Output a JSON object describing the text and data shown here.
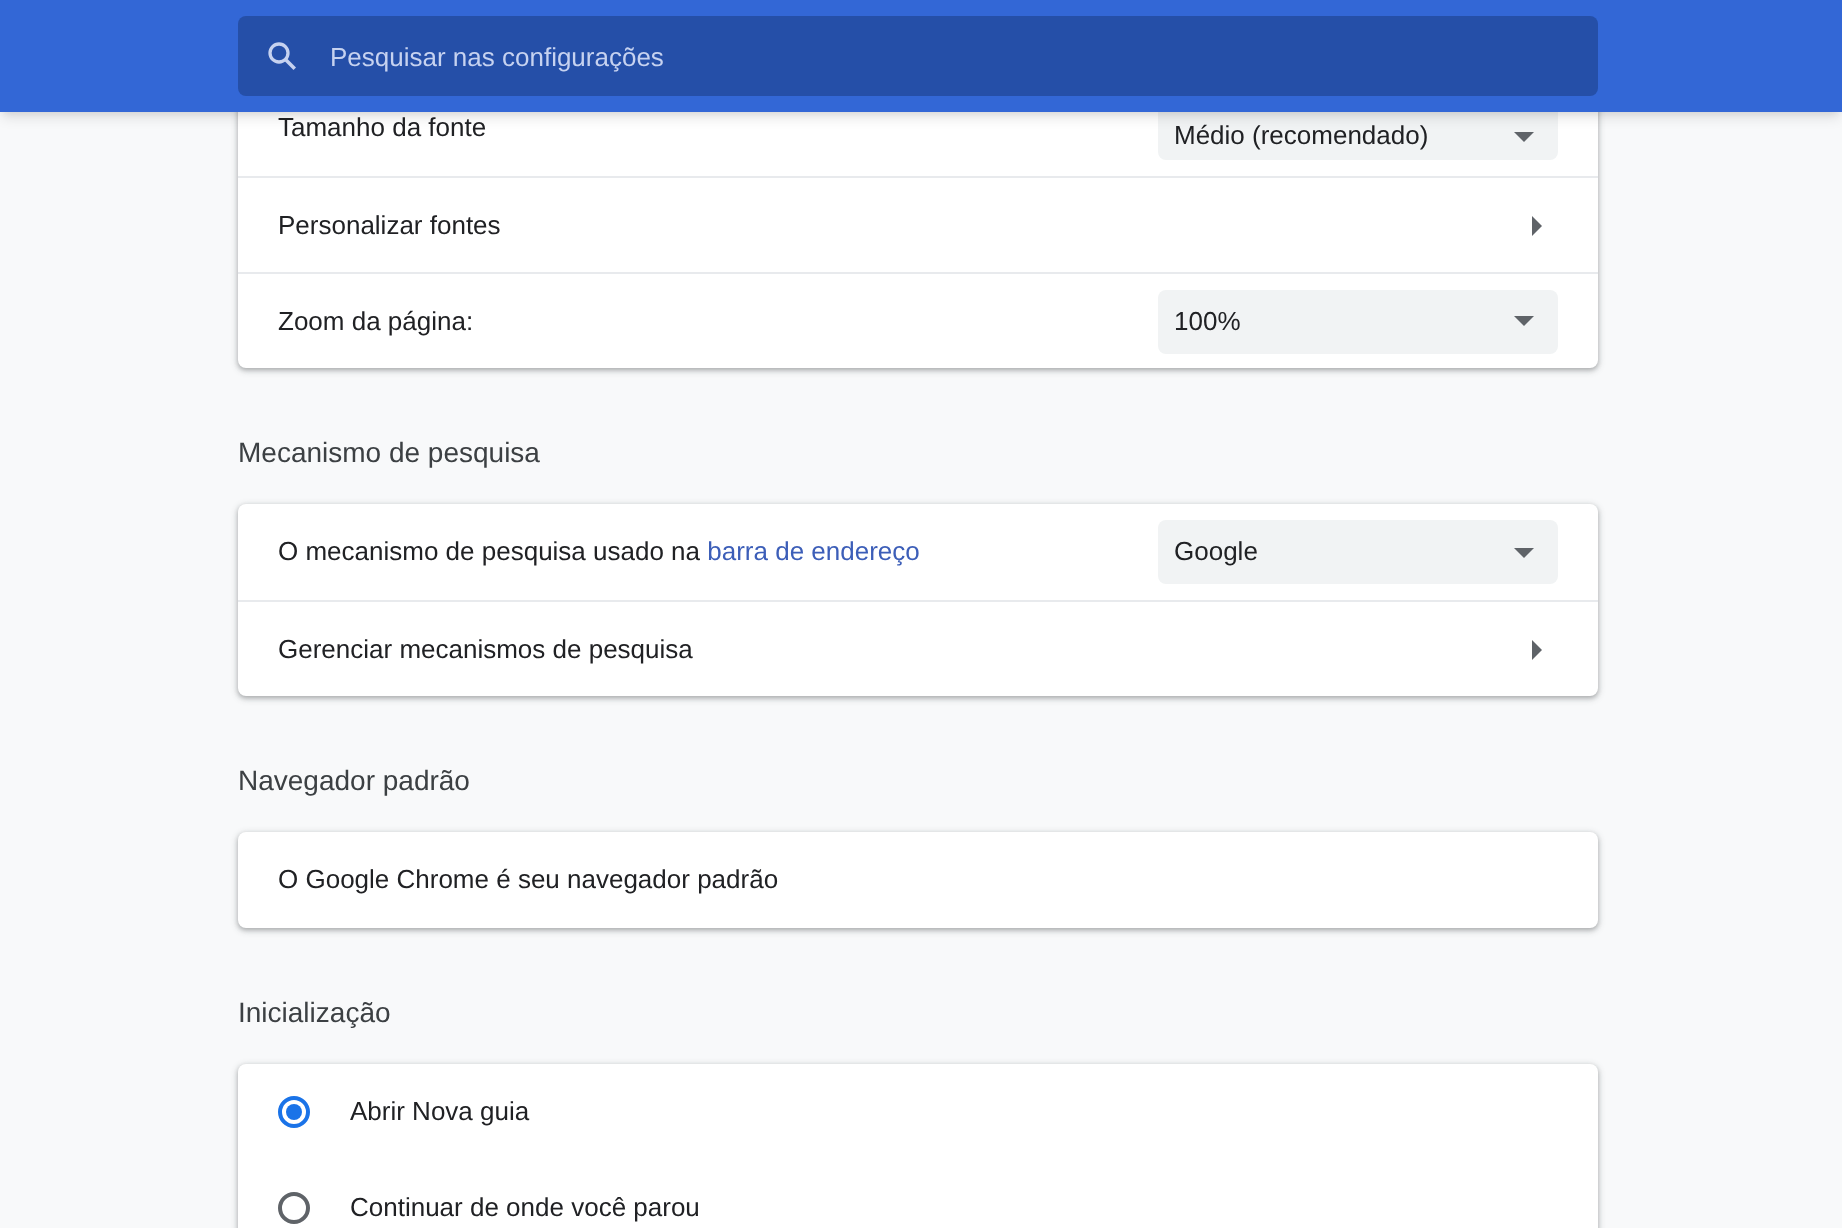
{
  "search": {
    "placeholder": "Pesquisar nas configurações"
  },
  "sections": [
    {
      "rows": [
        {
          "kind": "select",
          "label": "Tamanho da fonte",
          "value": "Médio (recomendado)"
        },
        {
          "kind": "link",
          "label": "Personalizar fontes"
        },
        {
          "kind": "select",
          "label": "Zoom da página:",
          "value": "100%"
        }
      ]
    },
    {
      "title": "Mecanismo de pesquisa",
      "rows": [
        {
          "kind": "select",
          "label": "O mecanismo de pesquisa usado na",
          "link": "barra de endereço",
          "value": "Google"
        },
        {
          "kind": "link",
          "label": "Gerenciar mecanismos de pesquisa"
        }
      ]
    },
    {
      "title": "Navegador padrão",
      "rows": [
        {
          "kind": "text",
          "label": "O Google Chrome é seu navegador padrão"
        }
      ]
    },
    {
      "title": "Inicialização",
      "rows": [
        {
          "kind": "radio",
          "label": "Abrir Nova guia",
          "selected": true
        },
        {
          "kind": "radio",
          "label": "Continuar de onde você parou",
          "selected": false
        }
      ]
    }
  ]
}
